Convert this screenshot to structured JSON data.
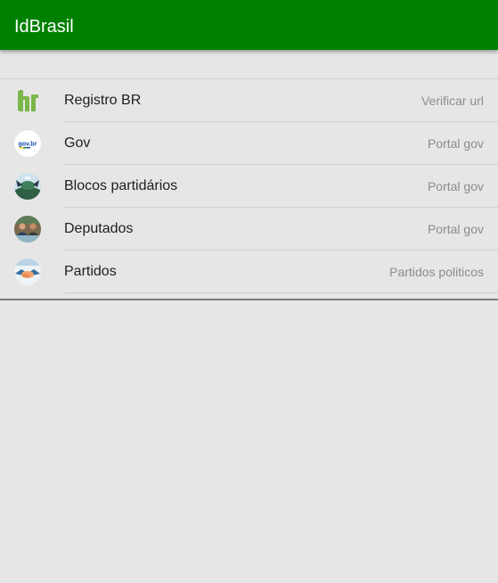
{
  "app": {
    "title": "IdBrasil",
    "header_color": "#008000",
    "background_color": "#e6e6e6"
  },
  "list": {
    "items": [
      {
        "title": "Registro BR",
        "subtitle": "Verificar url",
        "icon": "registro-br-logo-icon"
      },
      {
        "title": "Gov",
        "subtitle": "Portal gov",
        "icon": "gov-br-logo-icon",
        "icon_text": "gov.br"
      },
      {
        "title": "Blocos partidários",
        "subtitle": "Portal gov",
        "icon": "blocos-partidarios-thumbnail-icon"
      },
      {
        "title": "Deputados",
        "subtitle": "Portal gov",
        "icon": "deputados-thumbnail-icon"
      },
      {
        "title": "Partidos",
        "subtitle": "Partidos politicos",
        "icon": "handshake-thumbnail-icon"
      }
    ]
  }
}
